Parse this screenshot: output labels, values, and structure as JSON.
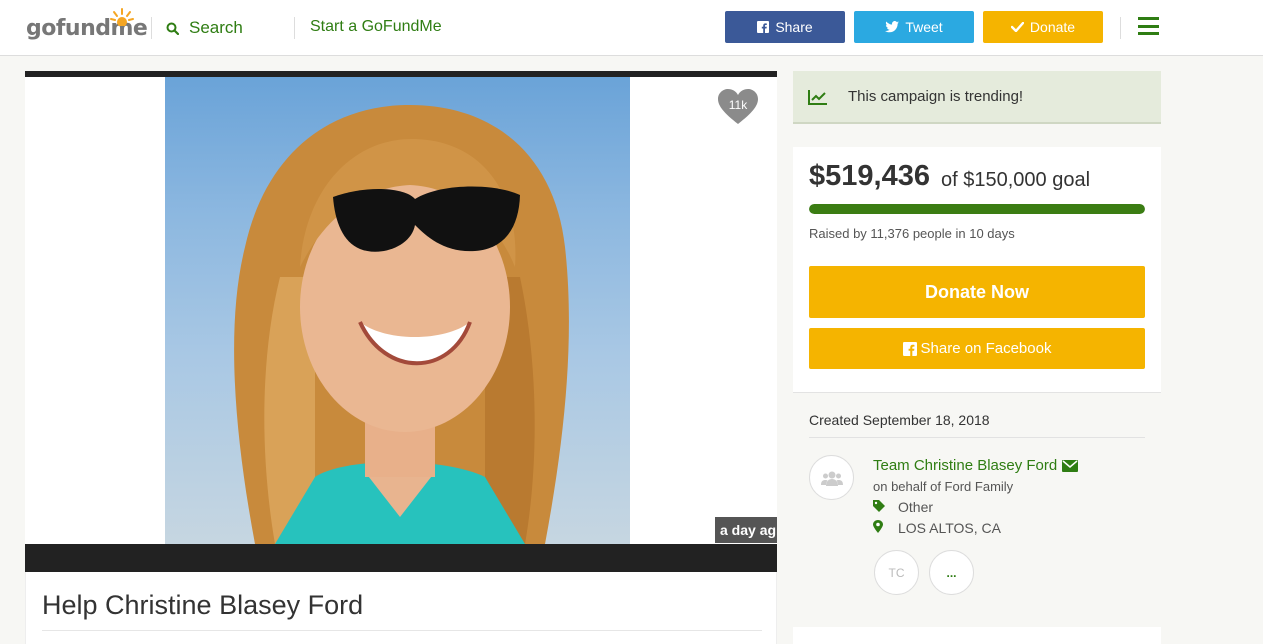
{
  "header": {
    "logo_text": "gofundme",
    "search_label": "Search",
    "start_link": "Start a GoFundMe",
    "share_label": "Share",
    "tweet_label": "Tweet",
    "donate_label": "Donate"
  },
  "campaign": {
    "title": "Help Christine Blasey Ford",
    "likes": "11k",
    "time_badge": "a day ag",
    "trending_text": "This campaign is trending!",
    "amount_raised": "$519,436",
    "goal_text": "of $150,000 goal",
    "progress_fraction": 1.0,
    "raised_text": "Raised by 11,376 people in 10 days",
    "donate_now_label": "Donate Now",
    "share_facebook_label": "Share on Facebook",
    "created_text": "Created September 18, 2018",
    "organizer_name": "Team Christine Blasey Ford",
    "on_behalf_text": "on behalf of Ford Family",
    "category": "Other",
    "location": "LOS ALTOS, CA",
    "team_initials": "TC",
    "more_label": "..."
  },
  "colors": {
    "brand_green": "#2f7d13",
    "progress_green": "#3b7d13",
    "donate_yellow": "#f5b400",
    "facebook_blue": "#3b5998",
    "twitter_blue": "#2ba9e1",
    "trending_bg": "#e5ebdc"
  }
}
